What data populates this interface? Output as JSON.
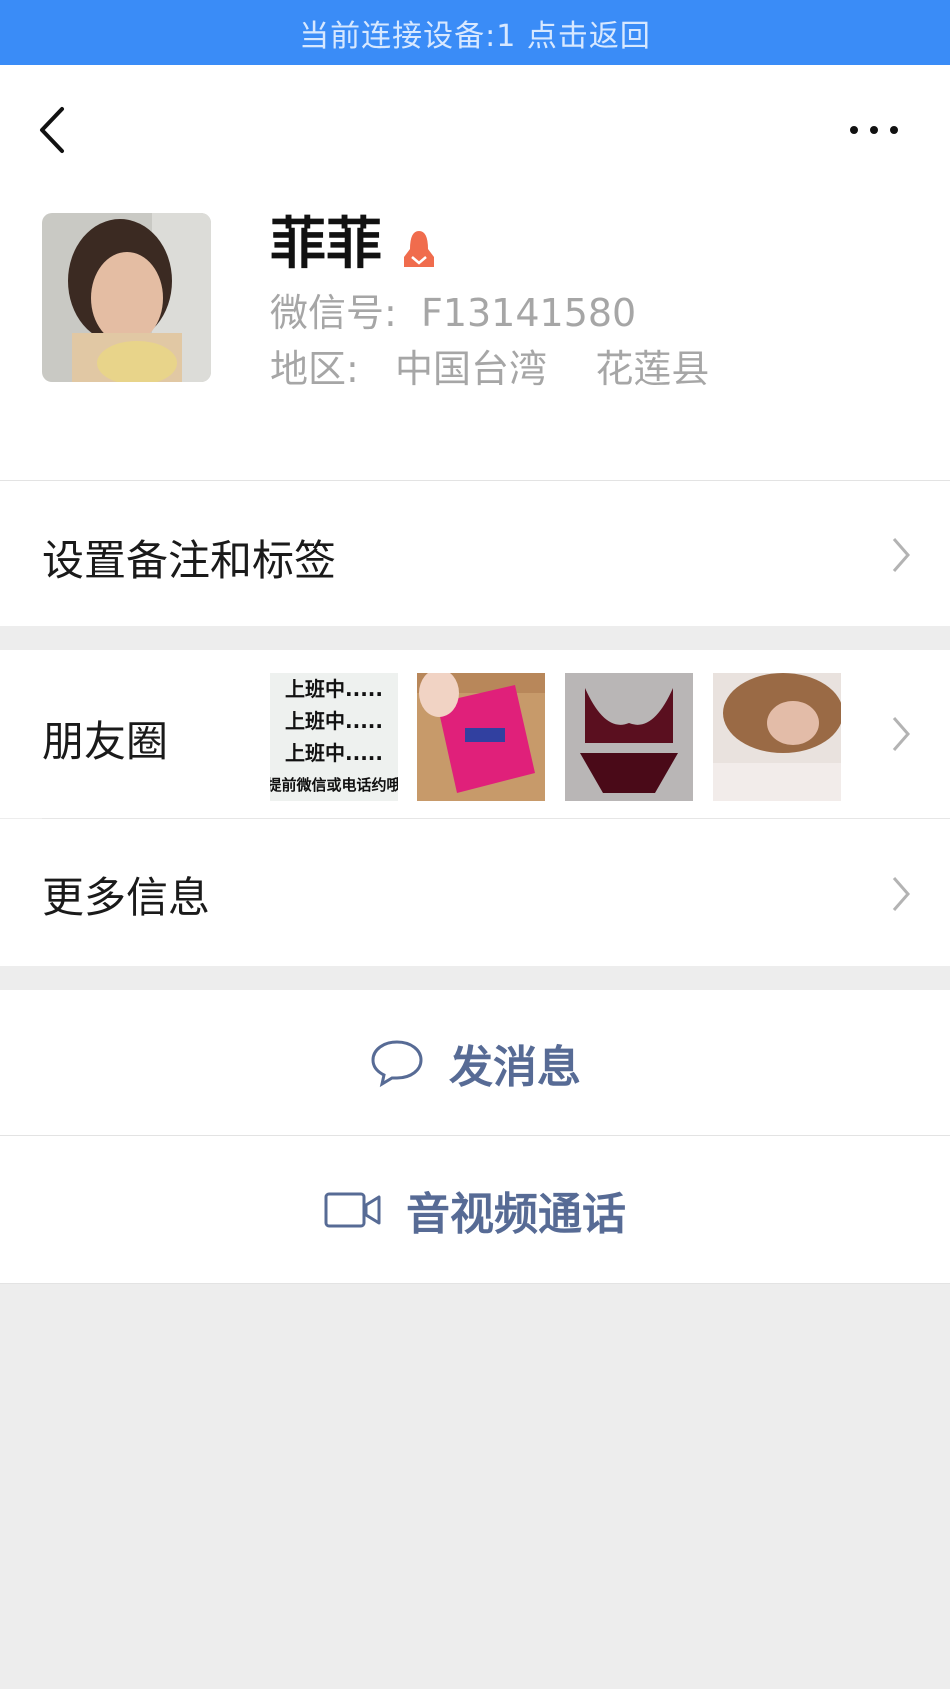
{
  "banner": {
    "text": "当前连接设备:1  点击返回"
  },
  "topbar": {
    "back_icon": "chevron-left-icon",
    "more_icon": "more-dots-icon"
  },
  "profile": {
    "name": "菲菲",
    "gender_icon": "female-icon",
    "gender_color": "#f06c4d",
    "wechat_id": "微信号:  F13141580",
    "region": "地区:   中国台湾    花莲县"
  },
  "rows": {
    "remark": "设置备注和标签",
    "moments": "朋友圈",
    "more_info": "更多信息"
  },
  "moments_thumbs": {
    "thumb1_lines": [
      "上班中.....",
      "上班中.....",
      "上班中.....",
      "提前微信或电话约哦"
    ]
  },
  "actions": {
    "message": "发消息",
    "video_call": "音视频通话",
    "color": "#576b95"
  }
}
